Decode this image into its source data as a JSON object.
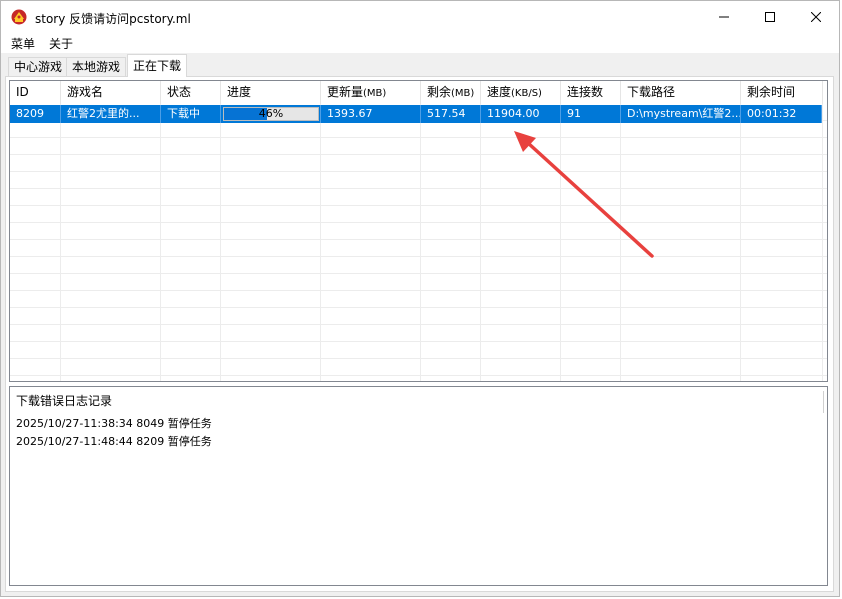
{
  "window": {
    "title": "story 反馈请访问pcstory.ml",
    "icon": "app-logo-icon"
  },
  "menu": [
    "菜单",
    "关于"
  ],
  "tabs": [
    {
      "label": "中心游戏"
    },
    {
      "label": "本地游戏"
    },
    {
      "label": "正在下载",
      "active": true
    }
  ],
  "table": {
    "columns": [
      {
        "label": "ID"
      },
      {
        "label": "游戏名"
      },
      {
        "label": "状态"
      },
      {
        "label": "进度"
      },
      {
        "label": "更新量",
        "unit": "(MB)"
      },
      {
        "label": "剩余",
        "unit": "(MB)"
      },
      {
        "label": "速度",
        "unit": "(KB/S)"
      },
      {
        "label": "连接数"
      },
      {
        "label": "下载路径"
      },
      {
        "label": "剩余时间"
      }
    ],
    "rows": [
      {
        "id": "8209",
        "name": "红警2尤里的...",
        "status": "下载中",
        "progress_text": "46%",
        "progress_fraction": 0.46,
        "update_mb": "1393.67",
        "remaining_mb": "517.54",
        "speed": "11904.00",
        "connections": "91",
        "path": "D:\\mystream\\红警2...",
        "time_left": "00:01:32"
      }
    ]
  },
  "log": {
    "title": "下载错误日志记录",
    "entries": [
      "2025/10/27-11:38:34 8049 暂停任务",
      "2025/10/27-11:48:44 8209 暂停任务"
    ]
  },
  "colors": {
    "selection": "#0078d7",
    "progress": "#0673d4",
    "annotation_arrow": "#e8413e"
  }
}
